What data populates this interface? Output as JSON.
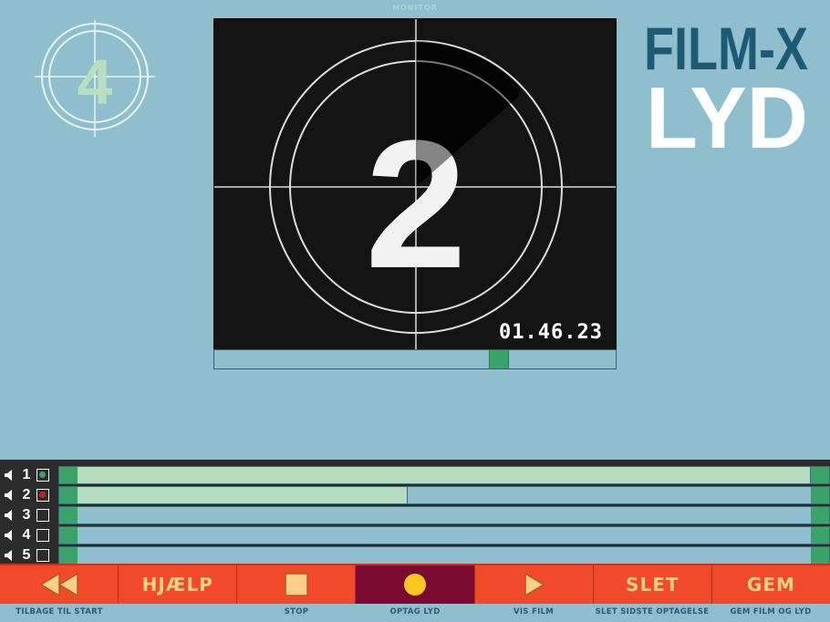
{
  "monitor": {
    "label": "MONITOR",
    "countdown_number": "2",
    "timecode": "01.46.23"
  },
  "logo": {
    "counter_number": "4"
  },
  "brand": {
    "line1": "FILM-X",
    "line2": "LYD"
  },
  "scrubber": {
    "position_fraction": 0.72
  },
  "tracks": [
    {
      "number": "1",
      "selected": true,
      "indicator": "green",
      "fill_fraction": 1.0
    },
    {
      "number": "2",
      "selected": true,
      "indicator": "red",
      "fill_fraction": 0.45
    },
    {
      "number": "3",
      "selected": false,
      "indicator": "none",
      "fill_fraction": 0
    },
    {
      "number": "4",
      "selected": false,
      "indicator": "none",
      "fill_fraction": 0
    },
    {
      "number": "5",
      "selected": false,
      "indicator": "none",
      "fill_fraction": 0
    }
  ],
  "toolbar": {
    "buttons": [
      {
        "icon": "rewind-icon",
        "label": "",
        "caption": "TILBAGE TIL START"
      },
      {
        "icon": "",
        "label": "HJÆLP",
        "caption": ""
      },
      {
        "icon": "stop-icon",
        "label": "",
        "caption": "STOP"
      },
      {
        "icon": "record-icon",
        "label": "",
        "caption": "OPTAG LYD",
        "active": true
      },
      {
        "icon": "play-icon",
        "label": "",
        "caption": "VIS FILM"
      },
      {
        "icon": "",
        "label": "SLET",
        "caption": "SLET SIDSTE OPTAGELSE"
      },
      {
        "icon": "",
        "label": "GEM",
        "caption": "GEM FILM OG LYD"
      }
    ]
  },
  "colors": {
    "background": "#8fbfcc",
    "accent_green": "#3aa36a",
    "track_fill": "#b3ddbe",
    "toolbar_red": "#f04a2a",
    "record_active": "#7a0a30",
    "button_text": "#f8d08a",
    "brand_dark": "#1f5a74"
  }
}
